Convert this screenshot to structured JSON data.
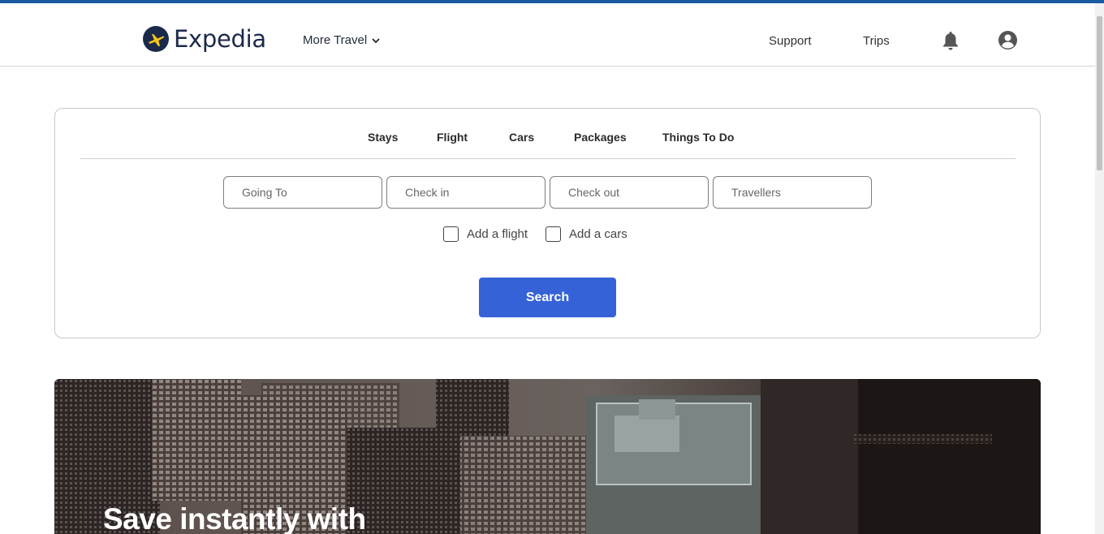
{
  "header": {
    "logo_text": "Expedia",
    "more_travel": "More Travel",
    "support": "Support",
    "trips": "Trips"
  },
  "search": {
    "tabs": [
      {
        "label": "Stays"
      },
      {
        "label": "Flight"
      },
      {
        "label": "Cars"
      },
      {
        "label": "Packages"
      },
      {
        "label": "Things To Do"
      }
    ],
    "fields": {
      "going_to": "Going To",
      "check_in": "Check in",
      "check_out": "Check out",
      "travellers": "Travellers"
    },
    "add_flight": "Add a flight",
    "add_cars": "Add a cars",
    "button": "Search"
  },
  "hero": {
    "title": "Save instantly with"
  },
  "colors": {
    "accent_bar": "#1a5aa0",
    "search_button": "#3662d8",
    "logo_mark": "#1c2a4a",
    "logo_plane": "#f5c518"
  }
}
